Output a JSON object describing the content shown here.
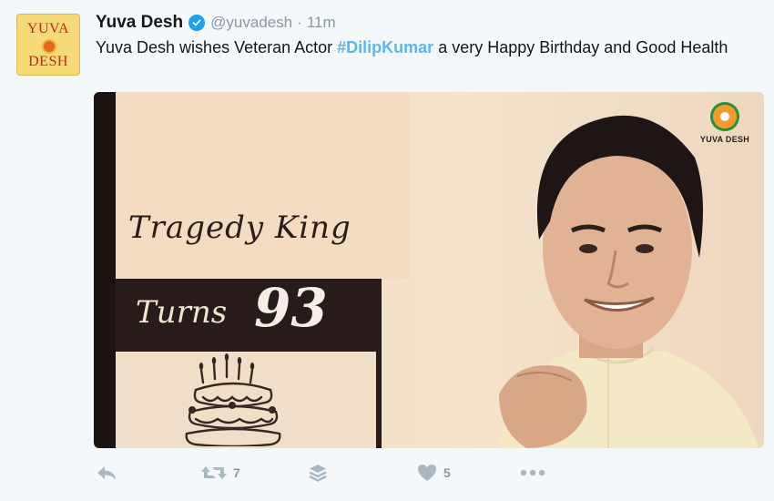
{
  "tweet": {
    "author": {
      "name": "Yuva Desh",
      "handle": "@yuvadesh",
      "time": "11m"
    },
    "avatar": {
      "line1": "YUVA",
      "line2": "DESH"
    },
    "text": {
      "before": "Yuva Desh wishes Veteran Actor ",
      "hashtag": "#DilipKumar",
      "after": " a very Happy Birthday and Good Health"
    },
    "separator": "·"
  },
  "media": {
    "headline": "Tragedy King",
    "turns": "Turns",
    "age": "93",
    "logo_text": "YUVA DESH"
  },
  "actions": {
    "reply": {
      "icon": "reply-icon"
    },
    "retweet": {
      "icon": "retweet-icon",
      "count": "7"
    },
    "buffer": {
      "icon": "layers-icon"
    },
    "like": {
      "icon": "heart-icon",
      "count": "5"
    },
    "more": {
      "icon": "more-icon"
    }
  },
  "colors": {
    "hashtag": "#5bb8ee",
    "verified": "#1da1f2",
    "muted": "#8899a6",
    "action_icon": "#aab8c2"
  }
}
